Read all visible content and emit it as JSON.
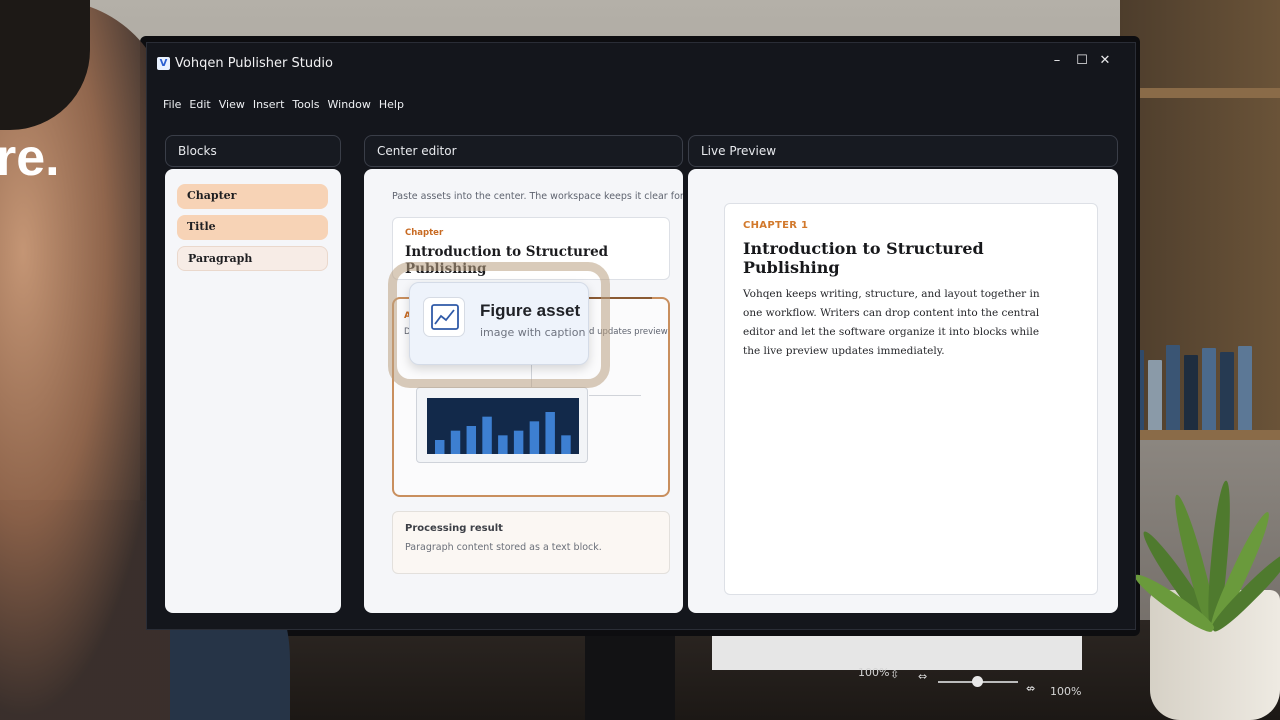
{
  "background": {
    "overlay_text": "re.",
    "status_bar": {
      "zoom_left": "100%",
      "zoom_right": "100%"
    }
  },
  "window": {
    "title": "Vohqen Publisher Studio",
    "logo_glyph": "V",
    "controls": {
      "minimize": "–",
      "maximize": "☐",
      "close": "✕"
    }
  },
  "menu": [
    "File",
    "Edit",
    "View",
    "Insert",
    "Tools",
    "Window",
    "Help"
  ],
  "panels": {
    "blocks": {
      "header": "Blocks",
      "items": [
        {
          "label": "Chapter",
          "color": "#f7d3b6"
        },
        {
          "label": "Title",
          "color": "#f7d3b6"
        },
        {
          "label": "Paragraph",
          "color": "#f7ece6"
        }
      ]
    },
    "editor": {
      "header": "Center editor",
      "hint": "Paste assets into the center. The workspace keeps it clear for the next item.",
      "chapter_card": {
        "label": "Chapter",
        "title": "Introduction to Structured Publishing"
      },
      "drop_card": {
        "fragment_label": "A",
        "fragment_text": "D",
        "fragment_right": "d updates preview"
      },
      "chart_values": [
        3,
        5,
        6,
        8,
        4,
        5,
        7,
        9,
        4
      ],
      "result_card": {
        "title": "Processing result",
        "text": "Paragraph content stored as a text block."
      }
    },
    "preview": {
      "header": "Live Preview",
      "chapter": "CHAPTER 1",
      "title": "Introduction to Structured Publishing",
      "body": "Vohqen keeps writing, structure, and layout together in one workflow. Writers can drop content into the central editor and let the software organize it into blocks while the live preview updates immediately."
    }
  },
  "drag_tile": {
    "title": "Figure asset",
    "subtitle": "image with caption",
    "icon": "chart-line-icon"
  },
  "colors": {
    "accent": "#c86a22",
    "chart_bar": "#3d7fd1",
    "chart_bg": "#12294a"
  }
}
